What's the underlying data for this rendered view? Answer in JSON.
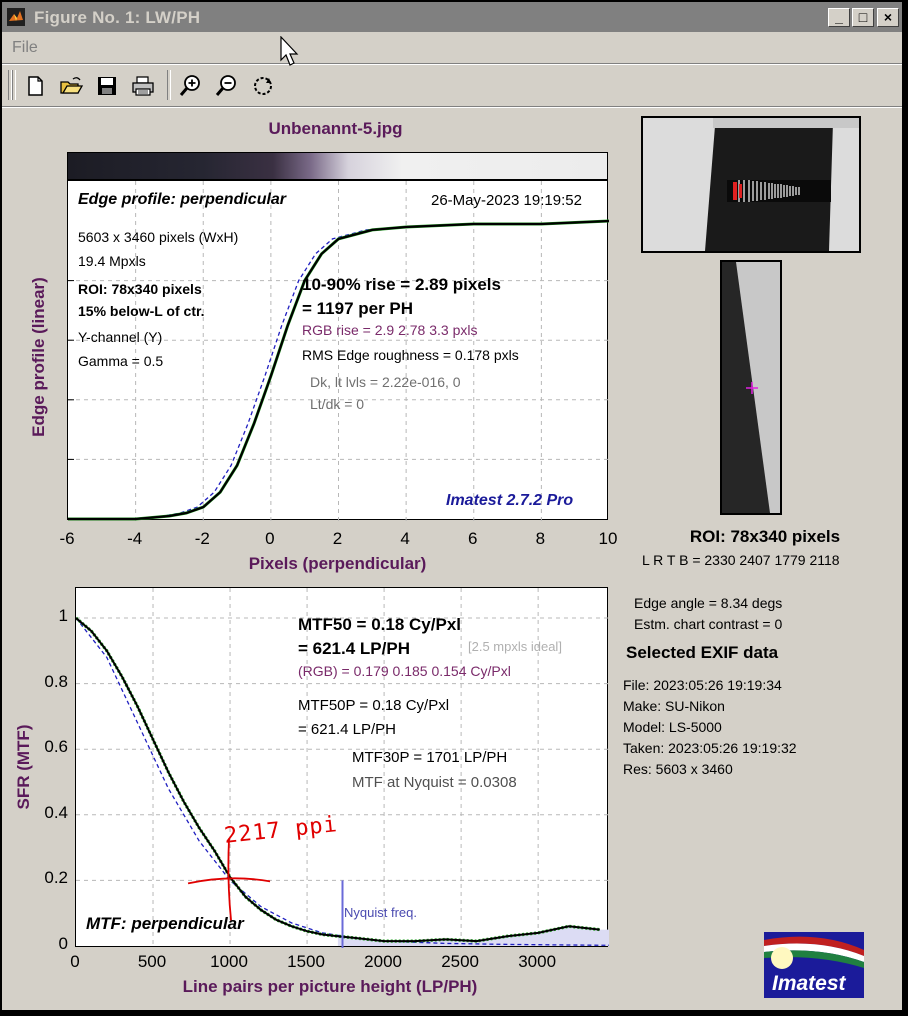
{
  "window": {
    "title": "Figure No. 1: LW/PH",
    "min_label": "_",
    "max_label": "□",
    "close_label": "×"
  },
  "menu": {
    "file": "File"
  },
  "toolbar": {
    "buttons": [
      "new-file-icon",
      "open-folder-icon",
      "save-disk-icon",
      "print-icon",
      "zoom-in-icon",
      "zoom-out-icon",
      "rotate-icon"
    ]
  },
  "file_title": "Unbenannt-5.jpg",
  "colors": {
    "axis_label": "#5a1a5a",
    "imatest_blue": "#1b1b9a",
    "rgb_purple": "#7a2a6a",
    "edge_dashed": "#2020c0",
    "annotation_red": "#e00000"
  },
  "edge_plot": {
    "header_title": "Edge profile: perpendicular",
    "header_date": "26-May-2023 19:19:52",
    "info_lines": [
      "5603 x 3460 pixels (WxH)",
      "19.4 Mpxls"
    ],
    "roi_lines": [
      "ROI:  78x340 pixels",
      "15% below-L of ctr."
    ],
    "channel_lines": [
      "Y-channel  (Y)",
      "Gamma = 0.5"
    ],
    "rise_line1": "10-90% rise = 2.89 pixels",
    "rise_line2": "= 1197 per PH",
    "rgb_rise": "RGB rise = 2.9  2.78  3.3 pxls",
    "rms": "RMS Edge roughness = 0.178 pxls",
    "dk_line": "Dk, lt lvls = 2.22e-016, 0",
    "lt_line": "Lt/dk = 0",
    "brand": "Imatest 2.7.2 Pro",
    "ylabel": "Edge profile (linear)",
    "xlabel": "Pixels (perpendicular)",
    "xticks": [
      "-6",
      "-4",
      "-2",
      "0",
      "2",
      "4",
      "6",
      "8",
      "10"
    ]
  },
  "mtf_plot": {
    "header_title": "MTF: perpendicular",
    "mtf50_line1": "MTF50 = 0.18 Cy/Pxl",
    "mtf50_line2": "= 621.4 LP/PH",
    "ideal_note": "[2.5 mpxls ideal]",
    "rgb_line": "(RGB) = 0.179  0.185  0.154 Cy/Pxl",
    "mtf50p_line1": "MTF50P = 0.18 Cy/Pxl",
    "mtf50p_line2": "= 621.4 LP/PH",
    "mtf30p": "MTF30P = 1701 LP/PH",
    "nyquist_mtf": "MTF at Nyquist = 0.0308",
    "nyquist_label": "Nyquist freq.",
    "handwritten_note": "2217 ppi",
    "ylabel": "SFR (MTF)",
    "xlabel": "Line pairs per picture height (LP/PH)",
    "xticks": [
      "0",
      "500",
      "1000",
      "1500",
      "2000",
      "2500",
      "3000"
    ],
    "yticks": [
      "1",
      "0.8",
      "0.6",
      "0.4",
      "0.2",
      "0"
    ]
  },
  "roi_panel": {
    "title": "ROI:  78x340 pixels",
    "coords": "L R  T B = 2330 2407  1779 2118"
  },
  "stats": {
    "edge_angle": "Edge angle = 8.34 degs",
    "contrast": "Estm. chart contrast = 0"
  },
  "exif": {
    "title": "Selected EXIF data",
    "rows": [
      "File:  2023:05:26 19:19:34",
      "Make:  SU-Nikon",
      "Model:  LS-5000",
      "Taken: 2023:05:26 19:19:32",
      "Res:    5603 x 3460"
    ]
  },
  "logo_text": "Imatest",
  "chart_data": [
    {
      "type": "line",
      "title": "Edge profile: perpendicular",
      "xlabel": "Pixels (perpendicular)",
      "ylabel": "Edge profile (linear)",
      "xlim": [
        -6,
        10
      ],
      "ylim": [
        0,
        1
      ],
      "grid": true,
      "series": [
        {
          "x": [
            -6,
            -4,
            -3,
            -2.5,
            -2,
            -1.5,
            -1,
            -0.5,
            0,
            0.5,
            1,
            1.5,
            2,
            3,
            4,
            6,
            8,
            10
          ],
          "values": [
            0.0,
            0.0,
            0.01,
            0.02,
            0.04,
            0.09,
            0.18,
            0.32,
            0.48,
            0.65,
            0.8,
            0.89,
            0.94,
            0.97,
            0.98,
            0.99,
            0.99,
            1.0
          ]
        }
      ]
    },
    {
      "type": "line",
      "title": "MTF: perpendicular",
      "xlabel": "Line pairs per picture height (LP/PH)",
      "ylabel": "SFR (MTF)",
      "xlim": [
        0,
        3460
      ],
      "ylim": [
        0,
        1.05
      ],
      "grid": true,
      "series": [
        {
          "x": [
            0,
            100,
            200,
            300,
            400,
            500,
            600,
            700,
            800,
            900,
            1000,
            1100,
            1200,
            1300,
            1400,
            1500,
            1600,
            1700,
            1800,
            2000,
            2200,
            2400,
            2600,
            2800,
            3000,
            3200,
            3400
          ],
          "values": [
            1.0,
            0.96,
            0.9,
            0.82,
            0.73,
            0.63,
            0.53,
            0.44,
            0.36,
            0.29,
            0.21,
            0.15,
            0.11,
            0.08,
            0.06,
            0.045,
            0.035,
            0.03,
            0.025,
            0.015,
            0.015,
            0.02,
            0.015,
            0.03,
            0.04,
            0.06,
            0.05
          ]
        },
        {
          "x": [
            0,
            200,
            400,
            600,
            800,
            1000,
            1200,
            1400,
            1600,
            1800,
            2000,
            2400,
            2800,
            3200,
            3460
          ],
          "values": [
            1.0,
            0.88,
            0.68,
            0.48,
            0.32,
            0.2,
            0.12,
            0.07,
            0.04,
            0.025,
            0.015,
            0.008,
            0.005,
            0.003,
            0.002
          ]
        }
      ]
    }
  ]
}
